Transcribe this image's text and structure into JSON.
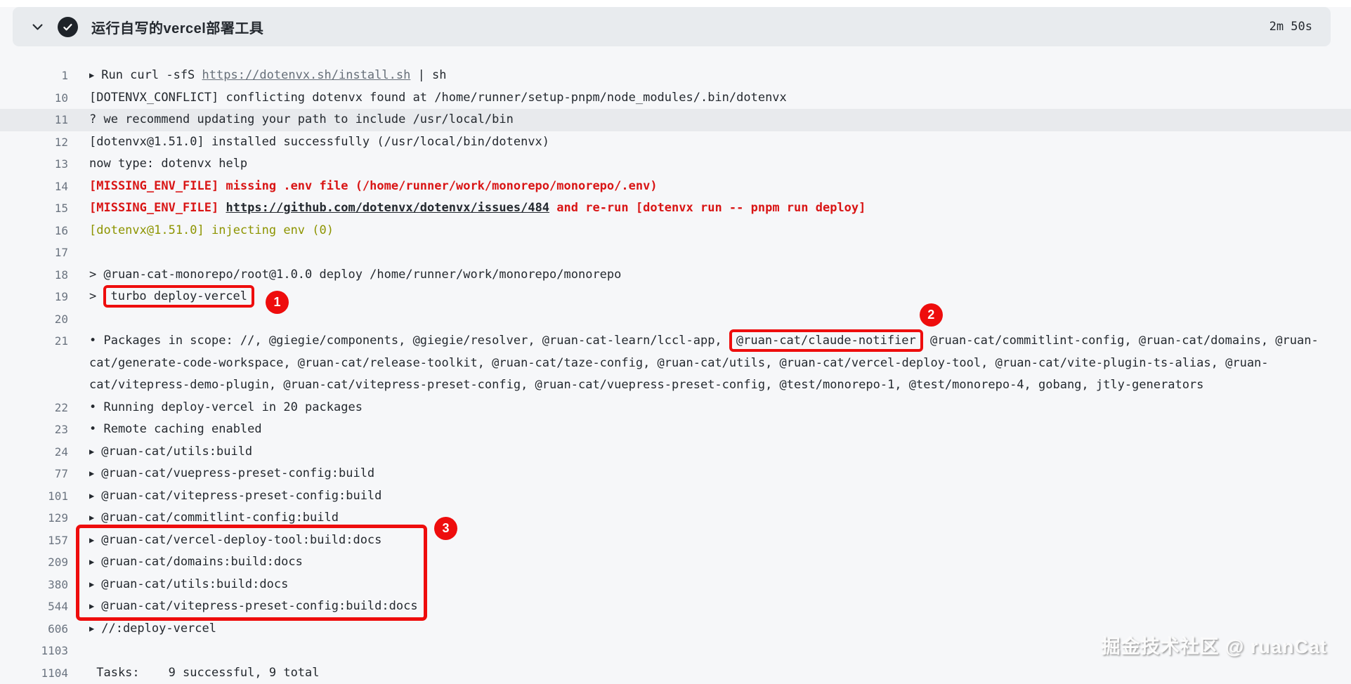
{
  "header": {
    "title": "运行自写的vercel部署工具",
    "duration": "2m 50s",
    "status": "success",
    "icons": {
      "collapse": "chevron-down-icon",
      "status": "check-circle-icon"
    }
  },
  "colors": {
    "header_bg": "#e8ebee",
    "page_bg": "#f6f7f9",
    "highlight_row_bg": "#e8eaed",
    "error_text": "#d91515",
    "warn_text": "#8d9400",
    "annotation_red": "#ee0d0d",
    "text": "#24292f",
    "line_number": "#6b7480"
  },
  "annotations": {
    "badge1": "1",
    "badge2": "2",
    "badge3": "3"
  },
  "watermark": "掘金技术社区 @ ruanCat",
  "log": {
    "rows": [
      {
        "num": "1",
        "parts": [
          {
            "t": "arrow",
            "v": "▶"
          },
          {
            "t": "text",
            "v": "Run curl -sfS "
          },
          {
            "t": "link",
            "v": "https://dotenvx.sh/install.sh"
          },
          {
            "t": "text",
            "v": " | sh"
          }
        ]
      },
      {
        "num": "10",
        "parts": [
          {
            "t": "text",
            "v": "[DOTENVX_CONFLICT] conflicting dotenvx found at /home/runner/setup-pnpm/node_modules/.bin/dotenvx"
          }
        ]
      },
      {
        "num": "11",
        "cls": "hl",
        "parts": [
          {
            "t": "text",
            "v": "? we recommend updating your path to include /usr/local/bin"
          }
        ]
      },
      {
        "num": "12",
        "parts": [
          {
            "t": "text",
            "v": "[dotenvx@1.51.0] installed successfully (/usr/local/bin/dotenvx)"
          }
        ]
      },
      {
        "num": "13",
        "parts": [
          {
            "t": "text",
            "v": "now type: dotenvx help"
          }
        ]
      },
      {
        "num": "14",
        "cls": "err",
        "parts": [
          {
            "t": "text",
            "v": "[MISSING_ENV_FILE] missing .env file (/home/runner/work/monorepo/monorepo/.env)"
          }
        ]
      },
      {
        "num": "15",
        "cls": "err",
        "parts": [
          {
            "t": "text",
            "v": "[MISSING_ENV_FILE] "
          },
          {
            "t": "linkdark",
            "v": "https://github.com/dotenvx/dotenvx/issues/484"
          },
          {
            "t": "text",
            "v": " and re-run [dotenvx run -- pnpm run deploy]"
          }
        ]
      },
      {
        "num": "16",
        "cls": "warn",
        "parts": [
          {
            "t": "text",
            "v": "[dotenvx@1.51.0] injecting env (0)"
          }
        ]
      },
      {
        "num": "17",
        "parts": []
      },
      {
        "num": "18",
        "parts": [
          {
            "t": "text",
            "v": "> @ruan-cat-monorepo/root@1.0.0 deploy /home/runner/work/monorepo/monorepo"
          }
        ]
      },
      {
        "num": "19",
        "parts": [
          {
            "t": "text",
            "v": "> "
          },
          {
            "t": "box",
            "v": "turbo deploy-vercel",
            "badge": "1",
            "badge_pos": "inline"
          }
        ]
      },
      {
        "num": "20",
        "parts": []
      },
      {
        "num": "21",
        "parts": [
          {
            "t": "text",
            "v": "• Packages in scope: //, @giegie/components, @giegie/resolver, @ruan-cat-learn/lccl-app, "
          },
          {
            "t": "box",
            "v": "@ruan-cat/claude-notifier",
            "badge": "2",
            "badge_pos": "above"
          },
          {
            "t": "text",
            "v": " @ruan-cat/commitlint-config, @ruan-cat/domains, @ruan-"
          }
        ]
      },
      {
        "num": "",
        "parts": [
          {
            "t": "text",
            "v": "cat/generate-code-workspace, @ruan-cat/release-toolkit, @ruan-cat/taze-config, @ruan-cat/utils, @ruan-cat/vercel-deploy-tool, @ruan-cat/vite-plugin-ts-alias, @ruan-"
          }
        ]
      },
      {
        "num": "",
        "parts": [
          {
            "t": "text",
            "v": "cat/vitepress-demo-plugin, @ruan-cat/vitepress-preset-config, @ruan-cat/vuepress-preset-config, @test/monorepo-1, @test/monorepo-4, gobang, jtly-generators"
          }
        ]
      },
      {
        "num": "22",
        "parts": [
          {
            "t": "text",
            "v": "• Running deploy-vercel in 20 packages"
          }
        ]
      },
      {
        "num": "23",
        "parts": [
          {
            "t": "text",
            "v": "• Remote caching enabled"
          }
        ]
      },
      {
        "num": "24",
        "parts": [
          {
            "t": "arrow",
            "v": "▶"
          },
          {
            "t": "text",
            "v": "@ruan-cat/utils:build"
          }
        ]
      },
      {
        "num": "77",
        "parts": [
          {
            "t": "arrow",
            "v": "▶"
          },
          {
            "t": "text",
            "v": "@ruan-cat/vuepress-preset-config:build"
          }
        ]
      },
      {
        "num": "101",
        "parts": [
          {
            "t": "arrow",
            "v": "▶"
          },
          {
            "t": "text",
            "v": "@ruan-cat/vitepress-preset-config:build"
          }
        ]
      },
      {
        "num": "129",
        "parts": [
          {
            "t": "arrow",
            "v": "▶"
          },
          {
            "t": "text",
            "v": "@ruan-cat/commitlint-config:build"
          }
        ]
      },
      {
        "num": "157",
        "parts": [
          {
            "t": "arrow",
            "v": "▶"
          },
          {
            "t": "text",
            "v": "@ruan-cat/vercel-deploy-tool:build:docs"
          }
        ]
      },
      {
        "num": "209",
        "parts": [
          {
            "t": "arrow",
            "v": "▶"
          },
          {
            "t": "text",
            "v": "@ruan-cat/domains:build:docs"
          }
        ]
      },
      {
        "num": "380",
        "parts": [
          {
            "t": "arrow",
            "v": "▶"
          },
          {
            "t": "text",
            "v": "@ruan-cat/utils:build:docs"
          }
        ]
      },
      {
        "num": "544",
        "parts": [
          {
            "t": "arrow",
            "v": "▶"
          },
          {
            "t": "text",
            "v": "@ruan-cat/vitepress-preset-config:build:docs"
          }
        ]
      },
      {
        "num": "606",
        "parts": [
          {
            "t": "arrow",
            "v": "▶"
          },
          {
            "t": "text",
            "v": "//:deploy-vercel"
          }
        ]
      },
      {
        "num": "1103",
        "parts": []
      },
      {
        "num": "1104",
        "parts": [
          {
            "t": "text",
            "v": " Tasks:    9 successful, 9 total"
          }
        ]
      }
    ]
  }
}
